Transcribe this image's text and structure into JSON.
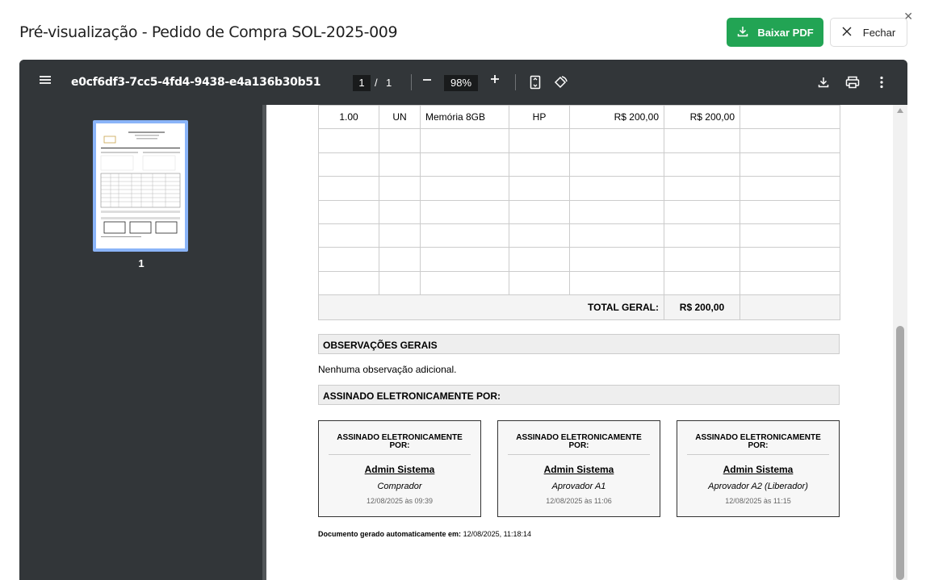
{
  "modal": {
    "title": "Pré-visualização - Pedido de Compra SOL-2025-009",
    "download_label": "Baixar PDF",
    "close_label": "Fechar"
  },
  "viewer": {
    "filename": "e0cf6df3-7cc5-4fd4-9438-e4a136b30b51",
    "current_page": "1",
    "page_sep": "/",
    "total_pages": "1",
    "zoom": "98%",
    "thumb_label": "1"
  },
  "document": {
    "item_row": {
      "qty": "1.00",
      "unit": "UN",
      "description": "Memória 8GB",
      "brand": "HP",
      "unit_price": "R$ 200,00",
      "total": "R$ 200,00"
    },
    "total_label": "TOTAL GERAL:",
    "total_value": "R$ 200,00",
    "obs_header": "OBSERVAÇÕES GERAIS",
    "obs_text": "Nenhuma observação adicional.",
    "signed_header": "ASSINADO ELETRONICAMENTE POR:",
    "signatures": [
      {
        "header": "ASSINADO ELETRONICAMENTE POR:",
        "name": "Admin Sistema",
        "role": "Comprador",
        "date": "12/08/2025 às 09:39"
      },
      {
        "header": "ASSINADO ELETRONICAMENTE POR:",
        "name": "Admin Sistema",
        "role": "Aprovador A1",
        "date": "12/08/2025 às 11:06"
      },
      {
        "header": "ASSINADO ELETRONICAMENTE POR:",
        "name": "Admin Sistema",
        "role": "Aprovador A2 (Liberador)",
        "date": "12/08/2025 às 11:15"
      }
    ],
    "generated_label": "Documento gerado automaticamente em:",
    "generated_value": "12/08/2025, 11:18:14"
  },
  "colors": {
    "primary_button": "#22a454",
    "toolbar": "#323639",
    "viewer_bg": "#525659",
    "thumb_highlight": "#8ab4f8"
  },
  "icons": [
    "download-icon",
    "close-icon",
    "menu-icon",
    "minus-icon",
    "plus-icon",
    "fit-page-icon",
    "rotate-icon",
    "print-icon",
    "more-vert-icon"
  ]
}
